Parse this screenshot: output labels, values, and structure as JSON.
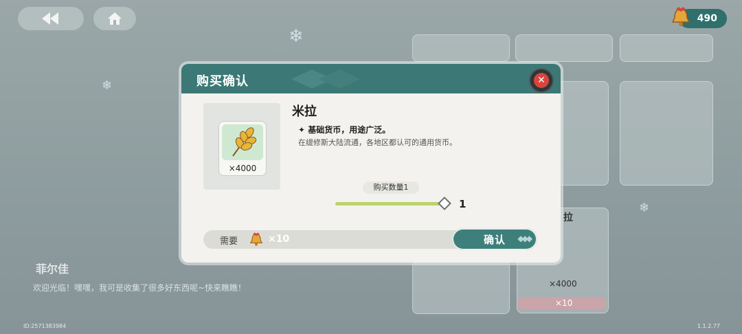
{
  "top_bar": {
    "back_icon": "double-left-arrow-icon",
    "home_icon": "home-icon",
    "currency_icon": "bell-icon",
    "currency_value": "490"
  },
  "dialog": {
    "title": "购买确认",
    "close_icon": "close-icon",
    "item": {
      "name": "米拉",
      "icon": "wheat-icon",
      "quantity_label": "×4000",
      "desc_headline": "✦ 基础货币，用途广泛。",
      "desc_body": "在缇修斯大陆流通，各地区都认可的通用货币。"
    },
    "purchase_quantity_label": "购买数量1",
    "slider": {
      "value": "1",
      "fill_fraction": 1.0
    },
    "cost": {
      "label": "需要",
      "icon": "bell-icon",
      "amount": "×10"
    },
    "confirm_label": "确认"
  },
  "background": {
    "shop_item_name": "拉",
    "shop_item_qty": "×4000",
    "shop_item_price": "×10",
    "npc_name": "菲尔佳",
    "npc_line": "欢迎光临！嘿嘿，我可是收集了很多好东西呢~快来瞧瞧！",
    "uid": "ID:2571383984",
    "version": "1.1.2.77"
  },
  "colors": {
    "header_teal": "#3b7876",
    "slider_green": "#b9d36b",
    "close_red": "#d9453b"
  }
}
